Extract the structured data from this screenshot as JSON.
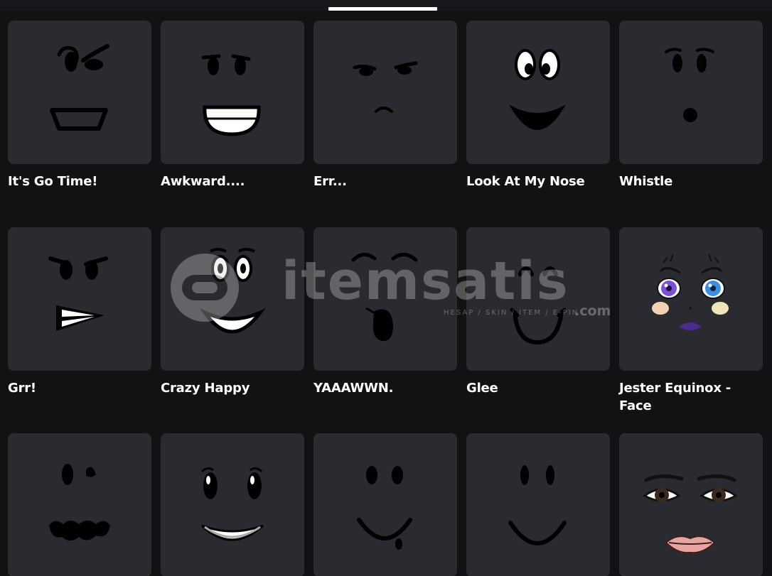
{
  "items": [
    {
      "name": "It's Go Time!",
      "face_icon": "go-time-face-icon"
    },
    {
      "name": "Awkward....",
      "face_icon": "awkward-face-icon"
    },
    {
      "name": "Err...",
      "face_icon": "err-face-icon"
    },
    {
      "name": "Look At My Nose",
      "face_icon": "look-at-my-nose-face-icon"
    },
    {
      "name": "Whistle",
      "face_icon": "whistle-face-icon"
    },
    {
      "name": "Grr!",
      "face_icon": "grr-face-icon"
    },
    {
      "name": "Crazy Happy",
      "face_icon": "crazy-happy-face-icon"
    },
    {
      "name": "YAAAWWN.",
      "face_icon": "yawn-face-icon"
    },
    {
      "name": "Glee",
      "face_icon": "glee-face-icon"
    },
    {
      "name": "Jester Equinox - Face",
      "face_icon": "jester-equinox-face-icon"
    },
    {
      "name": "",
      "face_icon": "worried-face-icon"
    },
    {
      "name": "",
      "face_icon": "shiny-smile-face-icon"
    },
    {
      "name": "",
      "face_icon": "drool-smile-face-icon"
    },
    {
      "name": "",
      "face_icon": "simple-smile-face-icon"
    },
    {
      "name": "",
      "face_icon": "lipstick-face-icon"
    }
  ],
  "watermark": {
    "brand": "itemsatis",
    "tagline": "HESAP / SKIN / ITEM / E-PIN",
    "domain": ".com"
  },
  "colors": {
    "background": "#111214",
    "card": "#2a2b31",
    "text": "#ffffff",
    "tab_indicator": "#ffffff"
  }
}
